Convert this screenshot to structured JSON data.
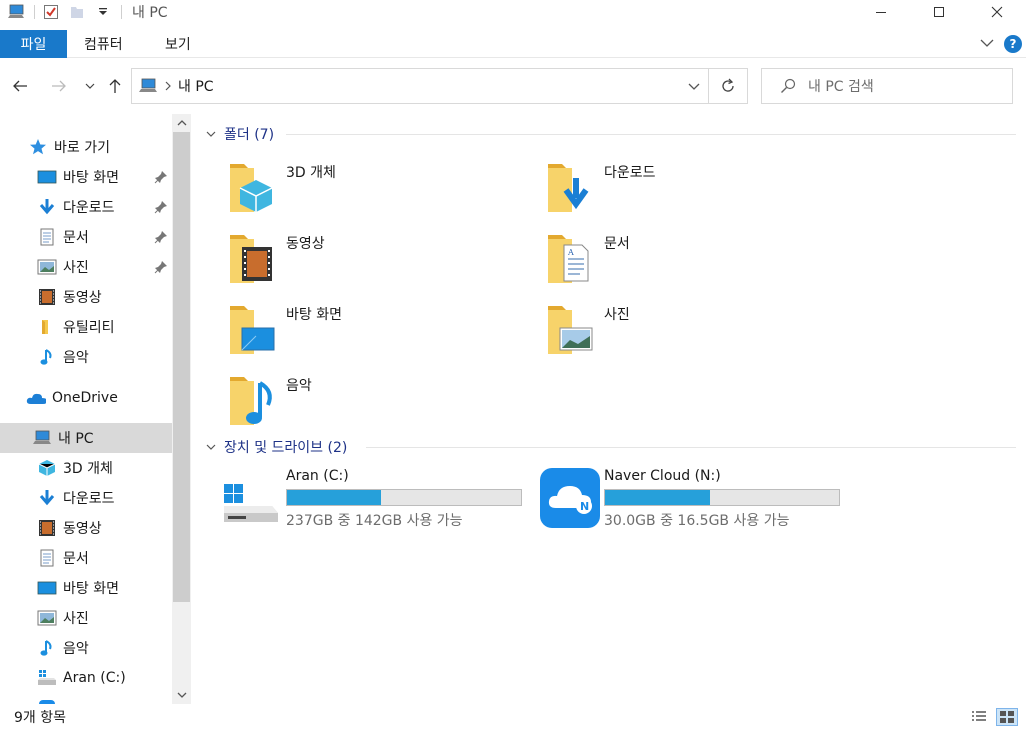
{
  "window": {
    "title": "내 PC"
  },
  "ribbon": {
    "file_tab": "파일",
    "tabs": [
      "컴퓨터",
      "보기"
    ]
  },
  "nav": {
    "address": "내 PC",
    "search_placeholder": "내 PC 검색"
  },
  "sidebar": {
    "quick_access": "바로 가기",
    "quick_items": [
      {
        "label": "바탕 화면",
        "icon": "desktop-icon",
        "pinned": true
      },
      {
        "label": "다운로드",
        "icon": "download-icon",
        "pinned": true
      },
      {
        "label": "문서",
        "icon": "document-icon",
        "pinned": true
      },
      {
        "label": "사진",
        "icon": "picture-icon",
        "pinned": true
      },
      {
        "label": "동영상",
        "icon": "video-icon",
        "pinned": false
      },
      {
        "label": "유틸리티",
        "icon": "folder-icon",
        "pinned": false
      },
      {
        "label": "음악",
        "icon": "music-icon",
        "pinned": false
      }
    ],
    "onedrive": "OneDrive",
    "this_pc": "내 PC",
    "pc_items": [
      {
        "label": "3D 개체",
        "icon": "cube-icon"
      },
      {
        "label": "다운로드",
        "icon": "download-icon"
      },
      {
        "label": "동영상",
        "icon": "video-icon"
      },
      {
        "label": "문서",
        "icon": "document-icon"
      },
      {
        "label": "바탕 화면",
        "icon": "desktop-icon"
      },
      {
        "label": "사진",
        "icon": "picture-icon"
      },
      {
        "label": "음악",
        "icon": "music-icon"
      },
      {
        "label": "Aran (C:)",
        "icon": "drive-icon"
      }
    ]
  },
  "folders": {
    "header": "폴더 (7)",
    "items": [
      {
        "label": "3D 개체",
        "icon": "cube-icon"
      },
      {
        "label": "다운로드",
        "icon": "download-icon"
      },
      {
        "label": "동영상",
        "icon": "video-icon"
      },
      {
        "label": "문서",
        "icon": "document-icon"
      },
      {
        "label": "바탕 화면",
        "icon": "desktop-icon"
      },
      {
        "label": "사진",
        "icon": "picture-icon"
      },
      {
        "label": "음악",
        "icon": "music-icon"
      }
    ]
  },
  "drives": {
    "header": "장치 및 드라이브 (2)",
    "items": [
      {
        "name": "Aran (C:)",
        "free_text": "237GB 중 142GB 사용 가능",
        "used_fraction": 0.4,
        "icon": "windows-drive-icon"
      },
      {
        "name": "Naver Cloud (N:)",
        "free_text": "30.0GB 중 16.5GB 사용 가능",
        "used_fraction": 0.45,
        "icon": "naver-cloud-icon"
      }
    ]
  },
  "status": {
    "count": "9개 항목"
  },
  "colors": {
    "accent": "#1979ca",
    "progress": "#26a0da",
    "folder": "#f5c94d",
    "group_header": "#1e3287"
  }
}
